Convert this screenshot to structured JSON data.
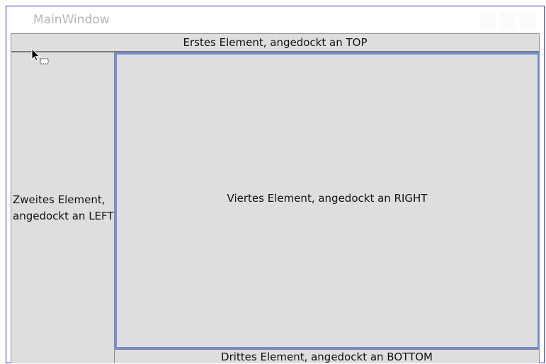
{
  "window": {
    "title": "MainWindow"
  },
  "dock": {
    "top_label": "Erstes Element, angedockt an TOP",
    "left_label_line1": "Zweites Element,",
    "left_label_line2": "angedockt an LEFT",
    "bottom_label": "Drittes Element, angedockt an BOTTOM",
    "right_label": "Viertes Element, angedockt an RIGHT"
  },
  "colors": {
    "window_border": "#2b2bd6",
    "client_background": "#dedede",
    "selected_highlight": "#6f8fd6",
    "title_text": "#b5b5b5"
  },
  "icons": {
    "cursor": "arrow-drag-copy-cursor-icon"
  }
}
